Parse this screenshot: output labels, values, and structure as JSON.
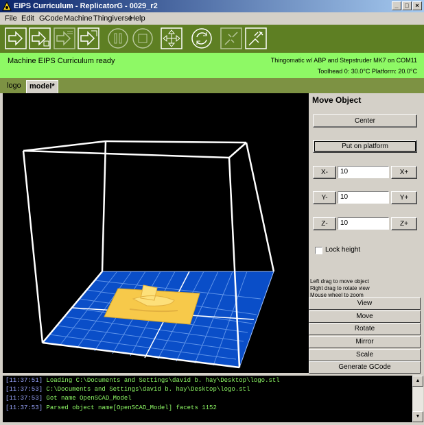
{
  "window": {
    "title": "EIPS Curriculum  - ReplicatorG - 0029_r2",
    "minimize": "_",
    "maximize": "□",
    "close": "×"
  },
  "menu": [
    "File",
    "Edit",
    "GCode",
    "Machine",
    "Thingiverse",
    "Help"
  ],
  "toolbar": {
    "buttons": [
      "build-icon",
      "upload-icon",
      "build-to-file-icon",
      "build-remote-icon",
      "pause-icon",
      "stop-icon",
      "control-panel-icon",
      "reset-icon",
      "disconnect-icon",
      "connect-icon"
    ]
  },
  "status": {
    "machine_status": "Machine EIPS Curriculum  ready",
    "machine_desc": "Thingomatic w/ ABP and Stepstruder MK7 on COM11",
    "temps": "Toolhead 0: 30.0°C  Platform: 20.0°C"
  },
  "tabs": [
    {
      "label": "logo",
      "active": false
    },
    {
      "label": "model*",
      "active": true
    }
  ],
  "panel": {
    "title": "Move Object",
    "center_label": "Center",
    "platform_label": "Put on platform",
    "x_minus": "X-",
    "x_plus": "X+",
    "x_value": "10",
    "y_minus": "Y-",
    "y_plus": "Y+",
    "y_value": "10",
    "z_minus": "Z-",
    "z_plus": "Z+",
    "z_value": "10",
    "lock_height_label": "Lock height",
    "lock_height_checked": false,
    "help_lines": [
      "Left drag to move object",
      "Right drag to rotate view",
      "Mouse wheel to zoom"
    ],
    "modes": [
      "View",
      "Move",
      "Rotate",
      "Mirror",
      "Scale",
      "Generate GCode"
    ]
  },
  "console": {
    "lines": [
      {
        "time": "[11:37:51]",
        "msg": " Loading C:\\Documents and Settings\\david b. hay\\Desktop\\logo.stl"
      },
      {
        "time": "[11:37:53]",
        "msg": " C:\\Documents and Settings\\david b. hay\\Desktop\\logo.stl"
      },
      {
        "time": "[11:37:53]",
        "msg": " Got name OpenSCAD_Model"
      },
      {
        "time": "[11:37:53]",
        "msg": " Parsed object name[OpenSCAD_Model] facets 1152"
      }
    ]
  },
  "colors": {
    "toolbar_bg": "#5e7f23",
    "status_bg": "#8ef965",
    "tab_bar_bg": "#7d9243",
    "platform_blue": "#0a4ec8",
    "object_yellow": "#f7c94a",
    "console_text": "#8ef965"
  }
}
